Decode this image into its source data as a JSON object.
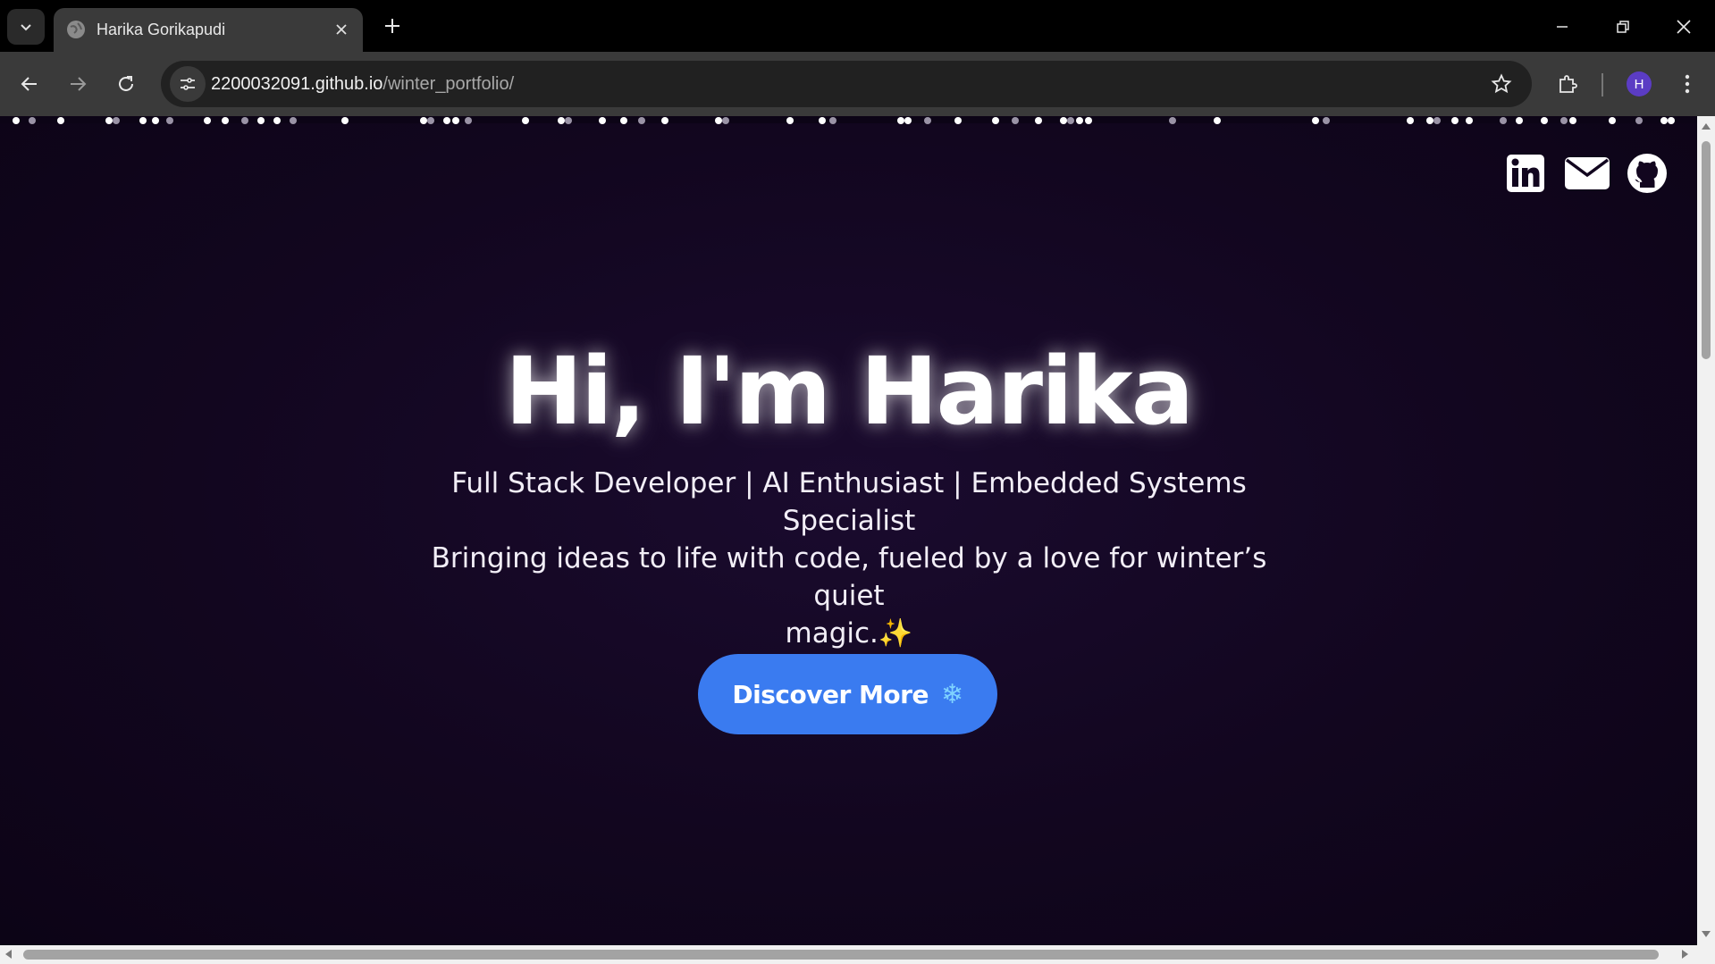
{
  "browser": {
    "tab_title": "Harika Gorikapudi",
    "url_host": "2200032091.github.io",
    "url_path": "/winter_portfolio/",
    "profile_initial": "H"
  },
  "social": {
    "linkedin_icon": "linkedin-icon",
    "email_icon": "envelope-icon",
    "github_icon": "github-icon"
  },
  "hero": {
    "title": "Hi, I'm Harika",
    "subtitle_line1": "Full Stack Developer | AI Enthusiast | Embedded Systems Specialist",
    "subtitle_line2": "Bringing ideas to life with code, fueled by a love for winter’s quiet",
    "subtitle_line3": "magic.✨",
    "cta_label": "Discover More",
    "cta_icon": "❄"
  },
  "colors": {
    "page_background": "#12061f",
    "cta_background": "#3a7bf0",
    "chrome_dark": "#000000",
    "chrome_toolbar": "#3a3a3a"
  }
}
